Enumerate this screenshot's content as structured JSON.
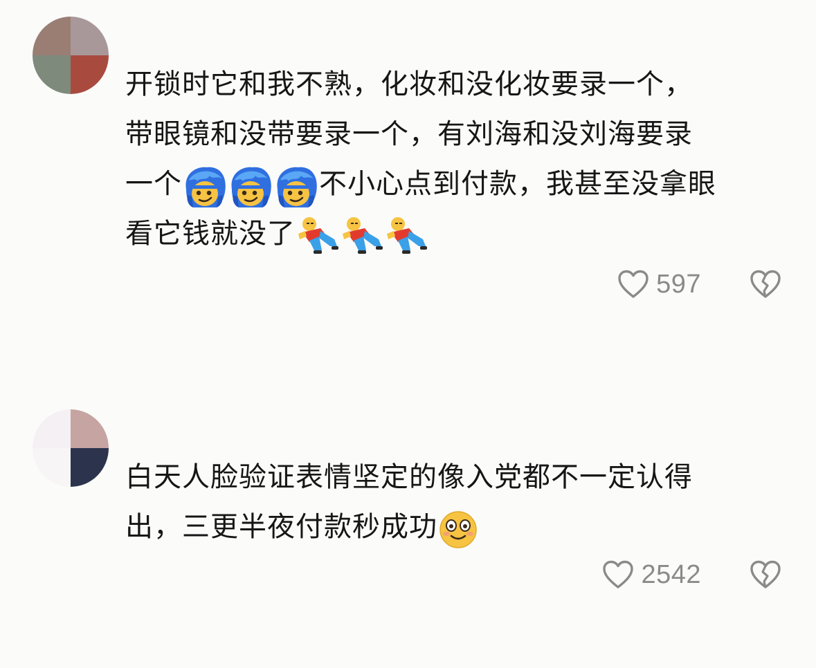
{
  "comments": [
    {
      "avatar": {
        "blocks": [
          "#9a7e74",
          "#a8989a",
          "#7d8a7c",
          "#a94a3f"
        ]
      },
      "text_line1": "开锁时它和我不熟，化妆和没化妆要录一个，",
      "text_line2": "带眼镜和没带要录一个，有刘海和没刘海要录",
      "text_line3a": "一个",
      "emoji_a": "blue-hair-smirk-emoji",
      "text_line3b": "不小心点到付款，我甚至没拿眼",
      "text_line4": "看它钱就没了",
      "emoji_b": "collapsed-person-emoji",
      "likes": "597"
    },
    {
      "avatar": {
        "blocks": [
          "#f4f0f3",
          "#c6a4a2",
          "#f7f5f5",
          "#2c344d"
        ]
      },
      "text_line1": "白天人脸验证表情坚定的像入党都不一定认得",
      "text_line2": "出，三更半夜付款秒成功",
      "emoji_c": "smiling-face-emoji",
      "likes": "2542"
    }
  ],
  "colors": {
    "background": "#fbfbf9",
    "text": "#161616",
    "meta": "#8a8a8a"
  },
  "icons": [
    "heart-outline-icon",
    "broken-heart-icon"
  ]
}
